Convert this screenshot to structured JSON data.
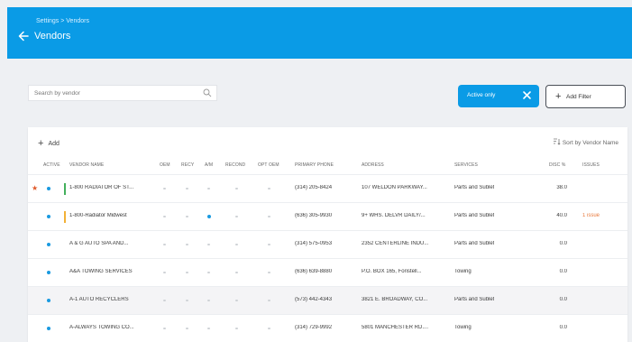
{
  "header": {
    "breadcrumb": "Settings > Vendors",
    "title": "Vendors"
  },
  "search": {
    "placeholder": "Search by vendor",
    "value": ""
  },
  "filters": {
    "active_chip": "Active only",
    "add_filter": "Add Filter"
  },
  "toolbar": {
    "add_label": "Add",
    "sort_label": "Sort by Vendor Name"
  },
  "columns": {
    "active": "ACTIVE",
    "vendor_name": "VENDOR NAME",
    "oem": "OEM",
    "recy": "RECY",
    "am": "A/M",
    "recond": "RECOND",
    "opt_oem": "OPT OEM",
    "primary_phone": "PRIMARY PHONE",
    "address": "ADDRESS",
    "services": "SERVICES",
    "disc": "DISC %",
    "issues": "ISSUES"
  },
  "colors": {
    "accent": "#0a9be6",
    "star": "#e05a2b",
    "issue": "#e8793b"
  },
  "rows": [
    {
      "starred": true,
      "flag_color": "#43b05c",
      "name": "1-800 RADIATOR OF ST...",
      "am": false,
      "phone": "(314) 205-8424",
      "address": "107 WELDON PARKWAY...",
      "services": "Parts and Sublet",
      "disc": "38.0",
      "issues": ""
    },
    {
      "starred": false,
      "flag_color": "#f2b136",
      "name": "1-800-Radiator Midwest",
      "am": true,
      "phone": "(636) 305-9930",
      "address": "9+ WHS. DELVR DAILY/...",
      "services": "Parts and Sublet",
      "disc": "40.0",
      "issues": "1 issue"
    },
    {
      "starred": false,
      "flag_color": "",
      "name": "A & G AUTO SPA AND...",
      "am": false,
      "phone": "(314) 575-0953",
      "address": "2352 CENTERLINE INDU...",
      "services": "Parts and Sublet",
      "disc": "0.0",
      "issues": ""
    },
    {
      "starred": false,
      "flag_color": "",
      "name": "A&A TOWING SERVICES",
      "am": false,
      "phone": "(636) 639-8880",
      "address": "P.O. BOX 165, Foristell...",
      "services": "Towing",
      "disc": "0.0",
      "issues": ""
    },
    {
      "starred": false,
      "flag_color": "",
      "name": "A-1 AUTO RECYCLERS",
      "am": false,
      "phone": "(573) 442-4343",
      "address": "3821 E. BROADWAY, CO...",
      "services": "Parts and Sublet",
      "disc": "0.0",
      "issues": ""
    },
    {
      "starred": false,
      "flag_color": "",
      "name": "A-ALWAYS TOWING CO...",
      "am": false,
      "phone": "(314) 729-9992",
      "address": "5801 MANCHESTER RD....",
      "services": "Towing",
      "disc": "0.0",
      "issues": ""
    }
  ]
}
